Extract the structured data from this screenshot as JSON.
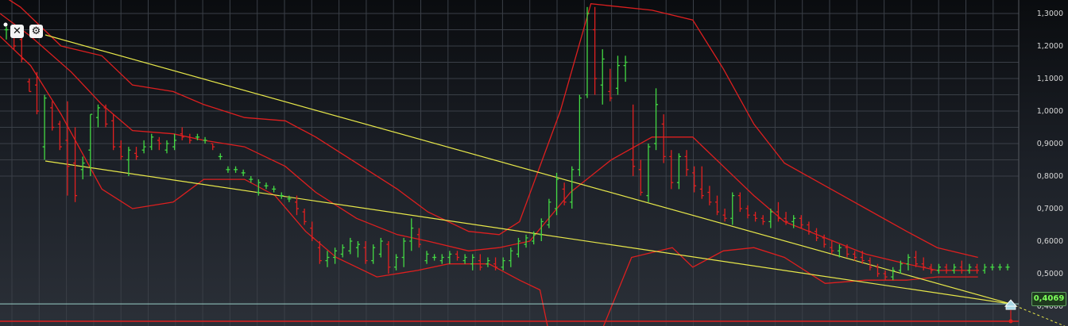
{
  "chart_data": {
    "type": "candlestick",
    "y_ticks": [
      "1,3000",
      "1,2000",
      "1,1000",
      "1,0000",
      "0,9000",
      "0,8000",
      "0,7000",
      "0,6000",
      "0,5000",
      "0,4000"
    ],
    "ylim": [
      0.39,
      1.33
    ],
    "current_price": 0.4069,
    "current_price_label": "0,4069",
    "grid": true,
    "colors": {
      "up": "#43d843",
      "down": "#e02020",
      "bands": "#dd1f1f",
      "trendline": "#e8e84a",
      "price_line": "#9ad0c8"
    },
    "bars": [
      [
        1.25,
        1.26,
        1.22,
        1.25
      ],
      [
        1.24,
        1.25,
        1.19,
        1.2
      ],
      [
        1.22,
        1.23,
        1.15,
        1.16
      ],
      [
        1.09,
        1.1,
        1.06,
        1.06
      ],
      [
        1.08,
        1.12,
        0.99,
        1.0
      ],
      [
        0.89,
        1.05,
        0.85,
        1.04
      ],
      [
        1.01,
        1.03,
        0.94,
        0.95
      ],
      [
        0.96,
        0.97,
        0.88,
        0.89
      ],
      [
        0.91,
        1.03,
        0.74,
        0.83
      ],
      [
        0.84,
        0.95,
        0.72,
        0.74
      ],
      [
        0.82,
        0.86,
        0.79,
        0.84
      ],
      [
        0.88,
        0.99,
        0.8,
        0.99
      ],
      [
        0.98,
        1.02,
        0.95,
        1.01
      ],
      [
        1.01,
        1.02,
        0.95,
        0.96
      ],
      [
        0.97,
        0.99,
        0.88,
        0.89
      ],
      [
        0.89,
        0.91,
        0.85,
        0.86
      ],
      [
        0.85,
        0.89,
        0.8,
        0.88
      ],
      [
        0.87,
        0.89,
        0.85,
        0.86
      ],
      [
        0.88,
        0.91,
        0.87,
        0.89
      ],
      [
        0.89,
        0.93,
        0.88,
        0.92
      ],
      [
        0.91,
        0.92,
        0.88,
        0.9
      ],
      [
        0.88,
        0.91,
        0.87,
        0.9
      ],
      [
        0.89,
        0.93,
        0.88,
        0.91
      ],
      [
        0.93,
        0.95,
        0.91,
        0.92
      ],
      [
        0.92,
        0.93,
        0.9,
        0.91
      ],
      [
        0.92,
        0.93,
        0.91,
        0.92
      ],
      [
        0.91,
        0.92,
        0.9,
        0.91
      ],
      [
        0.9,
        0.9,
        0.88,
        0.89
      ],
      [
        0.86,
        0.87,
        0.85,
        0.86
      ],
      [
        0.82,
        0.83,
        0.81,
        0.82
      ],
      [
        0.82,
        0.83,
        0.81,
        0.82
      ],
      [
        0.81,
        0.82,
        0.8,
        0.81
      ],
      [
        0.79,
        0.8,
        0.78,
        0.79
      ],
      [
        0.75,
        0.79,
        0.74,
        0.78
      ],
      [
        0.77,
        0.78,
        0.76,
        0.77
      ],
      [
        0.76,
        0.77,
        0.75,
        0.76
      ],
      [
        0.74,
        0.75,
        0.73,
        0.74
      ],
      [
        0.73,
        0.74,
        0.72,
        0.73
      ],
      [
        0.72,
        0.74,
        0.68,
        0.7
      ],
      [
        0.69,
        0.7,
        0.65,
        0.66
      ],
      [
        0.64,
        0.66,
        0.6,
        0.61
      ],
      [
        0.58,
        0.6,
        0.53,
        0.54
      ],
      [
        0.54,
        0.57,
        0.52,
        0.55
      ],
      [
        0.55,
        0.58,
        0.53,
        0.57
      ],
      [
        0.56,
        0.59,
        0.55,
        0.58
      ],
      [
        0.57,
        0.61,
        0.56,
        0.6
      ],
      [
        0.58,
        0.6,
        0.55,
        0.59
      ],
      [
        0.58,
        0.6,
        0.53,
        0.54
      ],
      [
        0.54,
        0.59,
        0.53,
        0.58
      ],
      [
        0.56,
        0.61,
        0.55,
        0.6
      ],
      [
        0.59,
        0.6,
        0.5,
        0.52
      ],
      [
        0.52,
        0.56,
        0.51,
        0.55
      ],
      [
        0.55,
        0.61,
        0.52,
        0.6
      ],
      [
        0.6,
        0.67,
        0.57,
        0.64
      ],
      [
        0.62,
        0.64,
        0.58,
        0.59
      ],
      [
        0.54,
        0.57,
        0.53,
        0.56
      ],
      [
        0.55,
        0.56,
        0.54,
        0.55
      ],
      [
        0.54,
        0.56,
        0.53,
        0.55
      ],
      [
        0.55,
        0.57,
        0.53,
        0.56
      ],
      [
        0.56,
        0.57,
        0.54,
        0.55
      ],
      [
        0.54,
        0.56,
        0.53,
        0.55
      ],
      [
        0.53,
        0.56,
        0.51,
        0.55
      ],
      [
        0.54,
        0.56,
        0.51,
        0.52
      ],
      [
        0.53,
        0.55,
        0.52,
        0.54
      ],
      [
        0.53,
        0.55,
        0.51,
        0.52
      ],
      [
        0.52,
        0.55,
        0.51,
        0.54
      ],
      [
        0.54,
        0.58,
        0.52,
        0.57
      ],
      [
        0.56,
        0.61,
        0.55,
        0.6
      ],
      [
        0.59,
        0.62,
        0.58,
        0.61
      ],
      [
        0.6,
        0.63,
        0.59,
        0.62
      ],
      [
        0.62,
        0.67,
        0.6,
        0.66
      ],
      [
        0.65,
        0.73,
        0.64,
        0.72
      ],
      [
        0.7,
        0.81,
        0.68,
        0.79
      ],
      [
        0.76,
        0.78,
        0.71,
        0.72
      ],
      [
        0.72,
        0.83,
        0.7,
        0.82
      ],
      [
        0.82,
        1.05,
        0.8,
        1.04
      ],
      [
        1.05,
        1.32,
        1.04,
        1.3
      ],
      [
        1.25,
        1.32,
        1.05,
        1.1
      ],
      [
        1.08,
        1.19,
        1.02,
        1.16
      ],
      [
        1.06,
        1.13,
        1.03,
        1.04
      ],
      [
        1.07,
        1.17,
        1.05,
        1.14
      ],
      [
        1.14,
        1.17,
        1.09,
        1.15
      ],
      [
        0.85,
        1.02,
        0.8,
        0.83
      ],
      [
        0.82,
        0.85,
        0.74,
        0.75
      ],
      [
        0.74,
        0.9,
        0.72,
        0.89
      ],
      [
        0.9,
        1.07,
        0.88,
        1.02
      ],
      [
        0.96,
        0.99,
        0.84,
        0.86
      ],
      [
        0.86,
        0.88,
        0.76,
        0.78
      ],
      [
        0.78,
        0.87,
        0.76,
        0.86
      ],
      [
        0.86,
        0.88,
        0.8,
        0.82
      ],
      [
        0.81,
        0.83,
        0.75,
        0.77
      ],
      [
        0.76,
        0.83,
        0.73,
        0.74
      ],
      [
        0.75,
        0.77,
        0.71,
        0.72
      ],
      [
        0.72,
        0.74,
        0.68,
        0.69
      ],
      [
        0.68,
        0.7,
        0.66,
        0.67
      ],
      [
        0.67,
        0.75,
        0.65,
        0.74
      ],
      [
        0.74,
        0.75,
        0.69,
        0.7
      ],
      [
        0.7,
        0.71,
        0.67,
        0.68
      ],
      [
        0.68,
        0.69,
        0.66,
        0.67
      ],
      [
        0.67,
        0.68,
        0.65,
        0.66
      ],
      [
        0.66,
        0.7,
        0.64,
        0.69
      ],
      [
        0.69,
        0.72,
        0.66,
        0.67
      ],
      [
        0.67,
        0.69,
        0.65,
        0.66
      ],
      [
        0.66,
        0.68,
        0.64,
        0.67
      ],
      [
        0.67,
        0.68,
        0.64,
        0.65
      ],
      [
        0.65,
        0.66,
        0.62,
        0.63
      ],
      [
        0.63,
        0.64,
        0.6,
        0.61
      ],
      [
        0.61,
        0.62,
        0.58,
        0.59
      ],
      [
        0.58,
        0.6,
        0.56,
        0.57
      ],
      [
        0.57,
        0.59,
        0.55,
        0.58
      ],
      [
        0.58,
        0.59,
        0.55,
        0.56
      ],
      [
        0.56,
        0.57,
        0.54,
        0.55
      ],
      [
        0.55,
        0.57,
        0.53,
        0.54
      ],
      [
        0.54,
        0.55,
        0.51,
        0.52
      ],
      [
        0.52,
        0.53,
        0.49,
        0.5
      ],
      [
        0.5,
        0.51,
        0.48,
        0.49
      ],
      [
        0.49,
        0.52,
        0.48,
        0.51
      ],
      [
        0.51,
        0.54,
        0.5,
        0.53
      ],
      [
        0.53,
        0.56,
        0.51,
        0.55
      ],
      [
        0.55,
        0.57,
        0.52,
        0.53
      ],
      [
        0.53,
        0.55,
        0.51,
        0.52
      ],
      [
        0.52,
        0.53,
        0.5,
        0.51
      ],
      [
        0.51,
        0.53,
        0.5,
        0.52
      ],
      [
        0.52,
        0.53,
        0.5,
        0.51
      ],
      [
        0.51,
        0.53,
        0.5,
        0.52
      ],
      [
        0.52,
        0.54,
        0.5,
        0.51
      ],
      [
        0.51,
        0.53,
        0.5,
        0.52
      ],
      [
        0.52,
        0.53,
        0.5,
        0.51
      ],
      [
        0.51,
        0.53,
        0.5,
        0.52
      ],
      [
        0.52,
        0.53,
        0.51,
        0.52
      ],
      [
        0.52,
        0.53,
        0.51,
        0.52
      ],
      [
        0.52,
        0.53,
        0.51,
        0.52
      ]
    ],
    "overlays": {
      "bollinger_upper": [
        [
          0.0,
          1.36
        ],
        [
          0.02,
          1.32
        ],
        [
          0.06,
          1.2
        ],
        [
          0.1,
          1.17
        ],
        [
          0.13,
          1.08
        ],
        [
          0.17,
          1.06
        ],
        [
          0.2,
          1.02
        ],
        [
          0.24,
          0.98
        ],
        [
          0.28,
          0.97
        ],
        [
          0.31,
          0.92
        ],
        [
          0.35,
          0.84
        ],
        [
          0.39,
          0.76
        ],
        [
          0.42,
          0.69
        ],
        [
          0.46,
          0.63
        ],
        [
          0.49,
          0.62
        ],
        [
          0.51,
          0.66
        ],
        [
          0.55,
          1.0
        ],
        [
          0.58,
          1.33
        ],
        [
          0.64,
          1.31
        ],
        [
          0.68,
          1.28
        ],
        [
          0.71,
          1.13
        ],
        [
          0.74,
          0.96
        ],
        [
          0.77,
          0.84
        ],
        [
          0.81,
          0.77
        ],
        [
          0.85,
          0.7
        ],
        [
          0.89,
          0.63
        ],
        [
          0.92,
          0.58
        ],
        [
          0.96,
          0.55
        ]
      ],
      "bollinger_middle": [
        [
          0.0,
          1.3
        ],
        [
          0.03,
          1.23
        ],
        [
          0.07,
          1.12
        ],
        [
          0.1,
          1.02
        ],
        [
          0.13,
          0.94
        ],
        [
          0.17,
          0.93
        ],
        [
          0.2,
          0.91
        ],
        [
          0.24,
          0.89
        ],
        [
          0.28,
          0.83
        ],
        [
          0.31,
          0.75
        ],
        [
          0.35,
          0.67
        ],
        [
          0.39,
          0.62
        ],
        [
          0.42,
          0.6
        ],
        [
          0.46,
          0.57
        ],
        [
          0.49,
          0.58
        ],
        [
          0.52,
          0.6
        ],
        [
          0.56,
          0.75
        ],
        [
          0.6,
          0.85
        ],
        [
          0.64,
          0.92
        ],
        [
          0.68,
          0.92
        ],
        [
          0.71,
          0.83
        ],
        [
          0.74,
          0.74
        ],
        [
          0.77,
          0.66
        ],
        [
          0.81,
          0.61
        ],
        [
          0.85,
          0.56
        ],
        [
          0.89,
          0.53
        ],
        [
          0.92,
          0.51
        ],
        [
          0.96,
          0.51
        ]
      ],
      "bollinger_lower": [
        [
          0.0,
          1.23
        ],
        [
          0.03,
          1.14
        ],
        [
          0.06,
          0.99
        ],
        [
          0.1,
          0.76
        ],
        [
          0.13,
          0.7
        ],
        [
          0.17,
          0.72
        ],
        [
          0.2,
          0.79
        ],
        [
          0.24,
          0.79
        ],
        [
          0.27,
          0.74
        ],
        [
          0.3,
          0.63
        ],
        [
          0.33,
          0.55
        ],
        [
          0.37,
          0.49
        ],
        [
          0.41,
          0.51
        ],
        [
          0.44,
          0.53
        ],
        [
          0.48,
          0.53
        ],
        [
          0.51,
          0.48
        ],
        [
          0.53,
          0.45
        ],
        [
          0.54,
          0.3
        ],
        [
          0.59,
          0.32
        ],
        [
          0.62,
          0.55
        ],
        [
          0.66,
          0.58
        ],
        [
          0.68,
          0.52
        ],
        [
          0.71,
          0.57
        ],
        [
          0.74,
          0.58
        ],
        [
          0.77,
          0.55
        ],
        [
          0.81,
          0.47
        ],
        [
          0.85,
          0.48
        ],
        [
          0.89,
          0.48
        ],
        [
          0.92,
          0.49
        ],
        [
          0.96,
          0.49
        ]
      ],
      "trendline_upper": [
        [
          1.23,
          0.03
        ],
        [
          0.4069,
          0.96
        ]
      ],
      "trendline_lower": [
        [
          0.84,
          0.04
        ],
        [
          0.4069,
          0.96
        ]
      ]
    }
  },
  "controls": {
    "close_label": "✕",
    "settings_label": "⚙"
  }
}
